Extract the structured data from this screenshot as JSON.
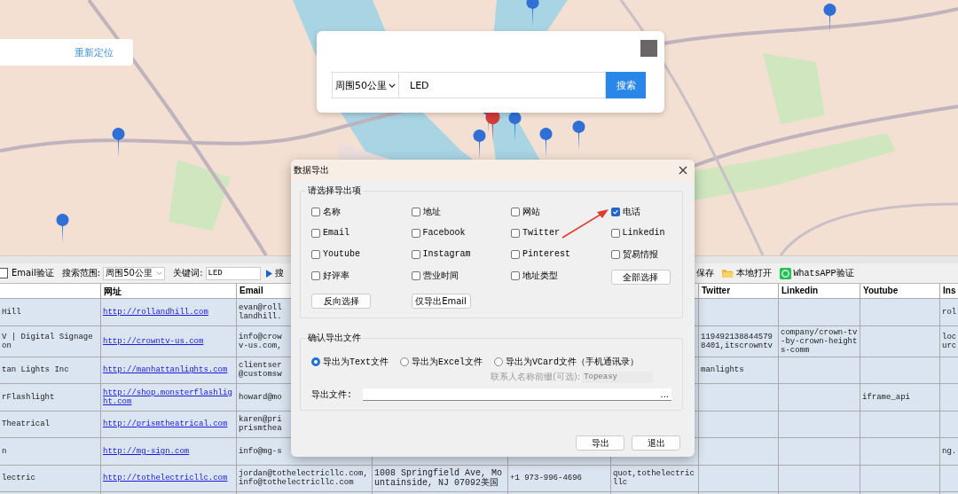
{
  "relocate_card": {
    "link": "重新定位"
  },
  "search_panel": {
    "range": "周围50公里",
    "keyword": "LED",
    "button": "搜索"
  },
  "toolbar": {
    "email_verify": {
      "label": "Email验证",
      "checked": false
    },
    "range_label": "搜索范围:",
    "range": "周围50公里",
    "keyword_label": "关键词:",
    "keyword": "LED",
    "search_button": "搜",
    "save": "保存",
    "open_local": "本地打开",
    "whatsapp_verify": "WhatsAPP验证"
  },
  "table": {
    "headers": {
      "url": "网址",
      "email": "Email",
      "twitter": "Twitter",
      "linkedin": "Linkedin",
      "youtube": "Youtube",
      "column_10": "Ins"
    },
    "rows": [
      {
        "column_1": "Hill",
        "url": "http://rollandhill.com",
        "email": "evan@roll\nlandhill.",
        "column_10": "rol"
      },
      {
        "column_1": "V | Digital Signage\non",
        "url": "http://crowntv-us.com",
        "email": "info@crow\nv-us.com,",
        "twitter": "1194921388445798401,itscrowntv",
        "linkedin": "company/crown-tv-by-crown-heights-comm",
        "column_10": "loc\nurc"
      },
      {
        "column_1": "tan Lights Inc",
        "url": "http://manhattanlights.com",
        "email": "clientser\n@customsw",
        "twitter": "manlights"
      },
      {
        "column_1": "rFlashlight",
        "url": "http://shop.monsterflashlight.com",
        "email": "howard@mo",
        "youtube": "iframe_api"
      },
      {
        "column_1": "Theatrical",
        "url": "http://prismtheatrical.com",
        "email": "karen@pri\nprismthea"
      },
      {
        "column_1": "n",
        "url": "http://mg-sign.com",
        "email": "info@mg-s",
        "column_10": "ng."
      },
      {
        "column_1": "lectric",
        "url": "http://tothelectricllc.com",
        "email": "jordan@tothelectricllc.com,info@tothelectricllc.com",
        "column_4": "1008 Springfield Ave, Mountainside, NJ 07092美国",
        "column_5": "+1 973-996-4696",
        "column_6": "quot,tothelectricllc"
      }
    ]
  },
  "dialog": {
    "title": "数据导出",
    "fields_group": "请选择导出项",
    "fields": [
      {
        "label": "名称",
        "checked": false
      },
      {
        "label": "地址",
        "checked": false
      },
      {
        "label": "网站",
        "checked": false
      },
      {
        "label": "电话",
        "checked": true
      },
      {
        "label": "Email",
        "checked": false
      },
      {
        "label": "Facebook",
        "checked": false
      },
      {
        "label": "Twitter",
        "checked": false
      },
      {
        "label": "Linkedin",
        "checked": false
      },
      {
        "label": "Youtube",
        "checked": false
      },
      {
        "label": "Instagram",
        "checked": false
      },
      {
        "label": "Pinterest",
        "checked": false
      },
      {
        "label": "贸易情报",
        "checked": false
      },
      {
        "label": "好评率",
        "checked": false
      },
      {
        "label": "营业时间",
        "checked": false
      },
      {
        "label": "地址类型",
        "checked": false
      }
    ],
    "field_buttons": [
      "全部选择",
      "反向选择",
      "仅导出Email"
    ],
    "file_group": "确认导出文件",
    "formats": [
      {
        "label": "导出为Text文件",
        "selected": true
      },
      {
        "label": "导出为Excel文件",
        "selected": false
      },
      {
        "label": "导出为VCard文件（手机通讯录）",
        "selected": false
      }
    ],
    "prefix_label": "联系人名称前缀(可选):",
    "prefix_value": "Topeasy",
    "file_label": "导出文件:",
    "browse": "...",
    "buttons": [
      "导出",
      "退出"
    ]
  }
}
